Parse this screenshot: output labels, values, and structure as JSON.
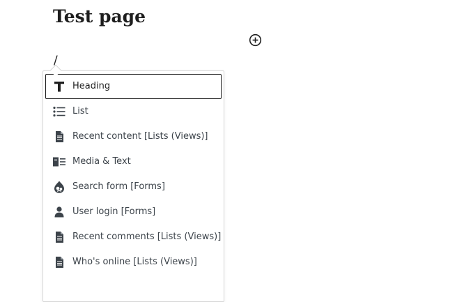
{
  "editor": {
    "title": "Test page",
    "typed_text": "/"
  },
  "colors": {
    "text": "#1e1e1e",
    "border": "#d6d6d6",
    "icon": "#3c434a"
  },
  "autocomplete": {
    "items": [
      {
        "label": "Heading",
        "icon": "heading-icon",
        "selected": true
      },
      {
        "label": "List",
        "icon": "list-icon"
      },
      {
        "label": "Recent content [Lists (Views)]",
        "icon": "document-icon"
      },
      {
        "label": "Media & Text",
        "icon": "media-text-icon"
      },
      {
        "label": "Search form [Forms]",
        "icon": "drupal-drop-icon"
      },
      {
        "label": "User login [Forms]",
        "icon": "user-icon"
      },
      {
        "label": "Recent comments [Lists (Views)]",
        "icon": "document-icon"
      },
      {
        "label": "Who's online [Lists (Views)]",
        "icon": "document-icon"
      }
    ]
  }
}
